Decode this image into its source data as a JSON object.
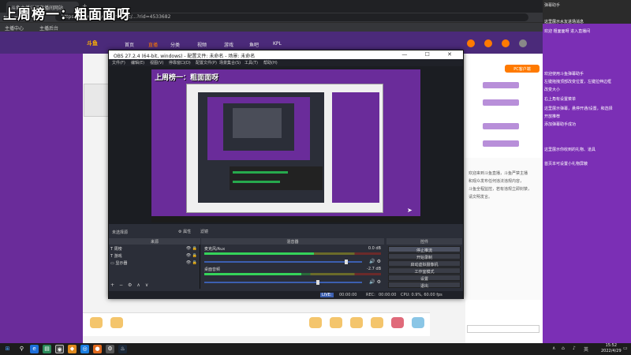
{
  "stream_title": "上周榜一：粗面面呀",
  "browser": {
    "tab_title": "斗鱼主播认证直播间网站",
    "url": "https://www.douyu.com/topic/...?rid=4533682",
    "bookmarks": [
      "主播中心",
      "主播后台"
    ]
  },
  "site": {
    "logo": "斗鱼",
    "nav": [
      "首页",
      "直播",
      "分类",
      "视频",
      "游戏",
      "鱼吧",
      "KPL"
    ],
    "active_nav_index": 1,
    "send_button": "PC客户端",
    "chat_lines": [
      "欢迎来到斗鱼直播，斗鱼严禁主播",
      "和观众发布任何违法违规内容，",
      "斗鱼全程监控，若有违规立即封禁，",
      "请文明发言。"
    ]
  },
  "right_panel": {
    "title": "弹幕助手",
    "top_messages": [
      "这里展示水友进场消息",
      "欢迎 粗面面呀 进入直播间"
    ],
    "messages": [
      "欢迎使用斗鱼弹幕助手",
      "左键拖拽顶部改变位置，左键拉伸边框",
      "改变大小",
      "右上角有设置菜单",
      "这里展示弹幕，悬停开通/设置，和选择",
      "开放推荐",
      "添加弹幕助手成功",
      "这里展示你收到的礼物、道具",
      "首页本可设置小礼物屏蔽"
    ]
  },
  "obs": {
    "title": "OBS 27.2.4 (64-bit, windows) - 配置文件: 未命名 - 场景: 未命名",
    "menu": [
      "文件(F)",
      "编辑(E)",
      "视图(V)",
      "停靠窗口(D)",
      "配置文件(P)",
      "场景集合(S)",
      "工具(T)",
      "帮助(H)"
    ],
    "preview_title": "上周榜一：粗面面呀",
    "scene_label": "未选择源",
    "toolbar": [
      "⚙ 属性",
      "滤镜"
    ],
    "docks": {
      "sources": "来源",
      "mixer": "混音器",
      "controls": "控件"
    },
    "sources": [
      {
        "icon": "T",
        "name": "周榜"
      },
      {
        "icon": "T",
        "name": "游戏"
      },
      {
        "icon": "▭",
        "name": "显示器"
      }
    ],
    "mixer": [
      {
        "name": "麦克风/Aux",
        "db": "0.0 dB",
        "level": 0.62,
        "volume": 0.9
      },
      {
        "name": "桌面音频",
        "db": "-2.7 dB",
        "level": 0.55,
        "volume": 0.72
      }
    ],
    "controls": [
      "停止推流",
      "开始录制",
      "启动虚拟摄像机",
      "工作室模式",
      "设置",
      "退出"
    ],
    "status": {
      "live": "LIVE:",
      "live_time": "00:00:00",
      "rec": "REC:",
      "rec_time": "00:00:00",
      "cpu": "CPU: 0.9%, 60.00 fps"
    }
  },
  "taskbar": {
    "time": "15:52",
    "date": "2022/4/29"
  }
}
